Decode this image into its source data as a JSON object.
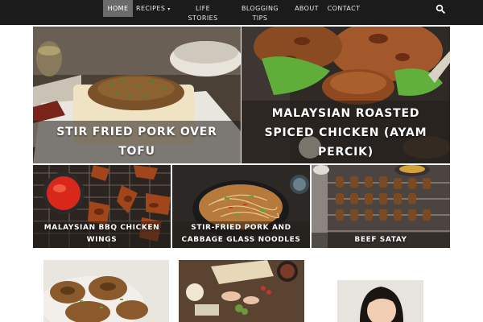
{
  "nav": {
    "items": [
      {
        "label": "Home",
        "active": true
      },
      {
        "label": "Recipes",
        "has_dropdown": true
      },
      {
        "label": "Life",
        "label2": "Stories"
      },
      {
        "label": "Blogging",
        "label2": "Tips"
      },
      {
        "label": "About"
      },
      {
        "label": "Contact"
      }
    ],
    "dropdown_glyph": "▾",
    "search_icon": "search-icon",
    "colors": {
      "bar": "#1b1b1b",
      "active": "#6b6b6b",
      "text": "#e6e6e6"
    }
  },
  "featured": [
    {
      "title_lines": [
        "STIR FRIED PORK OVER",
        "TOFU"
      ]
    },
    {
      "title_lines": [
        "MALAYSIAN ROASTED",
        "SPICED CHICKEN (AYAM",
        "PERCIK)"
      ]
    }
  ],
  "row2": [
    {
      "title_lines": [
        "MALAYSIAN BBQ CHICKEN",
        "WINGS"
      ]
    },
    {
      "title_lines": [
        "STIR-FRIED PORK AND",
        "CABBAGE GLASS NOODLES"
      ]
    },
    {
      "title_lines": [
        "BEEF SATAY"
      ]
    }
  ]
}
